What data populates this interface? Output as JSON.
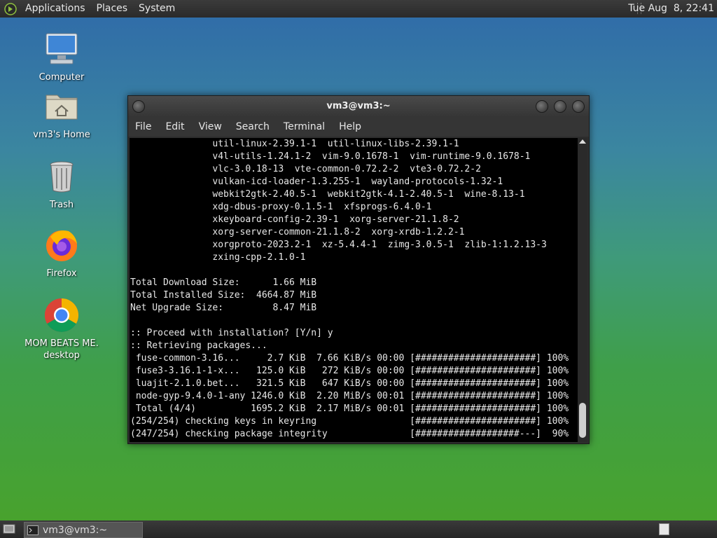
{
  "top_panel": {
    "menus": [
      "Applications",
      "Places",
      "System"
    ],
    "clock": "Tue Aug  8, 22:41"
  },
  "desktop_icons": [
    {
      "label": "Computer",
      "icon": "computer-icon"
    },
    {
      "label": "vm3's Home",
      "icon": "home-folder-icon"
    },
    {
      "label": "Trash",
      "icon": "trash-icon"
    },
    {
      "label": "Firefox",
      "icon": "firefox-icon"
    },
    {
      "label": "MOM BEATS ME.\ndesktop",
      "icon": "chrome-icon"
    }
  ],
  "terminal": {
    "title": "vm3@vm3:~",
    "menus": [
      "File",
      "Edit",
      "View",
      "Search",
      "Terminal",
      "Help"
    ],
    "lines": [
      "               util-linux-2.39.1-1  util-linux-libs-2.39.1-1",
      "               v4l-utils-1.24.1-2  vim-9.0.1678-1  vim-runtime-9.0.1678-1",
      "               vlc-3.0.18-13  vte-common-0.72.2-2  vte3-0.72.2-2",
      "               vulkan-icd-loader-1.3.255-1  wayland-protocols-1.32-1",
      "               webkit2gtk-2.40.5-1  webkit2gtk-4.1-2.40.5-1  wine-8.13-1",
      "               xdg-dbus-proxy-0.1.5-1  xfsprogs-6.4.0-1",
      "               xkeyboard-config-2.39-1  xorg-server-21.1.8-2",
      "               xorg-server-common-21.1.8-2  xorg-xrdb-1.2.2-1",
      "               xorgproto-2023.2-1  xz-5.4.4-1  zimg-3.0.5-1  zlib-1:1.2.13-3",
      "               zxing-cpp-2.1.0-1",
      "",
      "Total Download Size:      1.66 MiB",
      "Total Installed Size:  4664.87 MiB",
      "Net Upgrade Size:         8.47 MiB",
      "",
      ":: Proceed with installation? [Y/n] y",
      ":: Retrieving packages...",
      " fuse-common-3.16...     2.7 KiB  7.66 KiB/s 00:00 [######################] 100%",
      " fuse3-3.16.1-1-x...   125.0 KiB   272 KiB/s 00:00 [######################] 100%",
      " luajit-2.1.0.bet...   321.5 KiB   647 KiB/s 00:00 [######################] 100%",
      " node-gyp-9.4.0-1-any 1246.0 KiB  2.20 MiB/s 00:01 [######################] 100%",
      " Total (4/4)          1695.2 KiB  2.17 MiB/s 00:01 [######################] 100%",
      "(254/254) checking keys in keyring                 [######################] 100%",
      "(247/254) checking package integrity               [###################---]  90%"
    ]
  },
  "taskbar": {
    "window_button": "vm3@vm3:~"
  }
}
